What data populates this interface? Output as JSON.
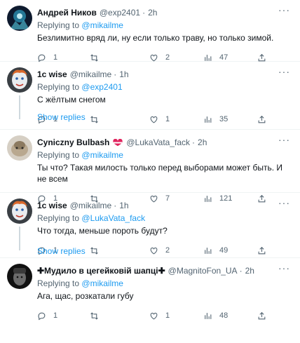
{
  "tweets": [
    {
      "name": "Андрей Ников",
      "handle": "@exp2401",
      "dot": "·",
      "time": "2h",
      "replying_prefix": "Replying to",
      "replying_to": "@mikailme",
      "text": "Безлимитно вряд ли, ну если только траву, но только зимой.",
      "reply_count": "1",
      "retweet_count": "",
      "like_count": "2",
      "view_count": "47"
    },
    {
      "name": "1c wise",
      "handle": "@mikailme",
      "dot": "·",
      "time": "1h",
      "replying_prefix": "Replying to",
      "replying_to": "@exp2401",
      "text": "С жёлтым снегом",
      "reply_count": "1",
      "retweet_count": "",
      "like_count": "1",
      "view_count": "35",
      "show_replies": "Show replies"
    },
    {
      "name": "Cyniczny Bulbash",
      "handle": "@LukaVata_fack",
      "dot": "·",
      "time": "2h",
      "replying_prefix": "Replying to",
      "replying_to": "@mikailme",
      "text": "Ты что? Такая милость только перед выборами может быть. И не всем",
      "reply_count": "1",
      "retweet_count": "",
      "like_count": "7",
      "view_count": "121"
    },
    {
      "name": "1c wise",
      "handle": "@mikailme",
      "dot": "·",
      "time": "1h",
      "replying_prefix": "Replying to",
      "replying_to": "@LukaVata_fack",
      "text": "Что тогда, меньше пороть будут?",
      "reply_count": "1",
      "retweet_count": "",
      "like_count": "2",
      "view_count": "49",
      "show_replies": "Show replies"
    },
    {
      "name": "✚Мудило в цегейковій шапці✚",
      "handle": "@MagnitoFon_UA",
      "dot": "·",
      "time": "2h",
      "replying_prefix": "Replying to",
      "replying_to": "@mikailme",
      "text": "Ага, щас, розкатали губу",
      "reply_count": "1",
      "retweet_count": "",
      "like_count": "1",
      "view_count": "48"
    }
  ],
  "more_glyph": "···",
  "colors": {
    "accent": "#1d9bf0",
    "muted": "#536471",
    "text": "#0f1419",
    "border": "#eff3f4"
  },
  "icons": [
    "reply-icon",
    "retweet-icon",
    "like-icon",
    "views-icon",
    "share-icon",
    "more-icon",
    "heart-badge-icon"
  ]
}
